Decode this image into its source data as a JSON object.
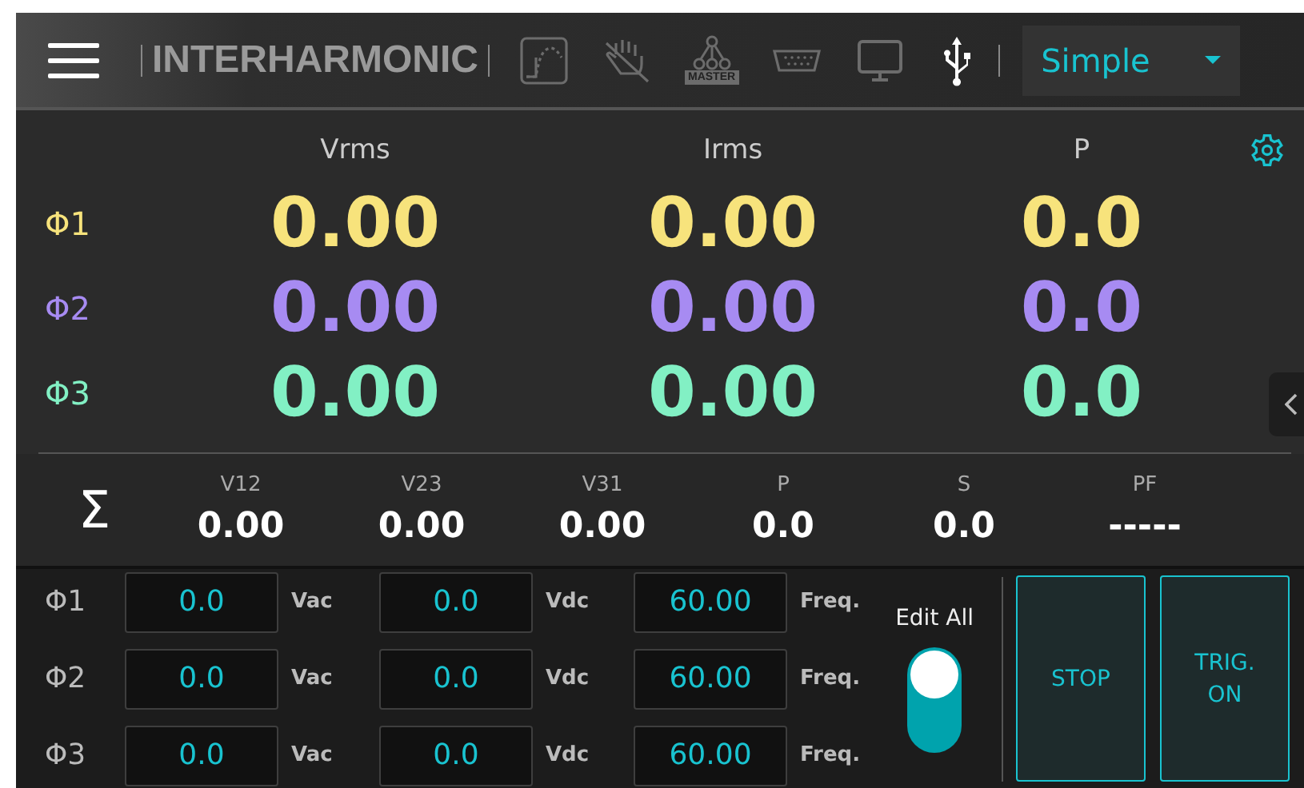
{
  "toolbar": {
    "title": "INTERHARMONIC",
    "icons": [
      {
        "kind": "curve",
        "active": false
      },
      {
        "kind": "hand",
        "active": false
      },
      {
        "kind": "master",
        "label": "MASTER",
        "active": false
      },
      {
        "kind": "serial",
        "active": false
      },
      {
        "kind": "monitor",
        "active": false
      },
      {
        "kind": "usb",
        "active": true
      }
    ],
    "mode": {
      "value": "Simple"
    }
  },
  "readings": {
    "columns": [
      "Vrms",
      "Irms",
      "P"
    ],
    "phases": [
      {
        "label": "Φ1",
        "color": "#f7e37c",
        "values": [
          "0.00",
          "0.00",
          "0.0"
        ]
      },
      {
        "label": "Φ2",
        "color": "#a78bf2",
        "values": [
          "0.00",
          "0.00",
          "0.0"
        ]
      },
      {
        "label": "Φ3",
        "color": "#82f0c4",
        "values": [
          "0.00",
          "0.00",
          "0.0"
        ]
      }
    ]
  },
  "summary": {
    "symbol": "Σ",
    "items": [
      {
        "label": "V12",
        "value": "0.00"
      },
      {
        "label": "V23",
        "value": "0.00"
      },
      {
        "label": "V31",
        "value": "0.00"
      },
      {
        "label": "P",
        "value": "0.0"
      },
      {
        "label": "S",
        "value": "0.0"
      },
      {
        "label": "PF",
        "value": "-----"
      }
    ]
  },
  "settings": [
    {
      "phase": "Φ1",
      "vac": "0.0",
      "vac_unit": "Vac",
      "vdc": "0.0",
      "vdc_unit": "Vdc",
      "freq": "60.00",
      "freq_unit": "Freq."
    },
    {
      "phase": "Φ2",
      "vac": "0.0",
      "vac_unit": "Vac",
      "vdc": "0.0",
      "vdc_unit": "Vdc",
      "freq": "60.00",
      "freq_unit": "Freq."
    },
    {
      "phase": "Φ3",
      "vac": "0.0",
      "vac_unit": "Vac",
      "vdc": "0.0",
      "vdc_unit": "Vdc",
      "freq": "60.00",
      "freq_unit": "Freq."
    }
  ],
  "edit_all": {
    "label": "Edit All",
    "on": true
  },
  "buttons": [
    "STOP",
    "TRIG.\nON"
  ]
}
